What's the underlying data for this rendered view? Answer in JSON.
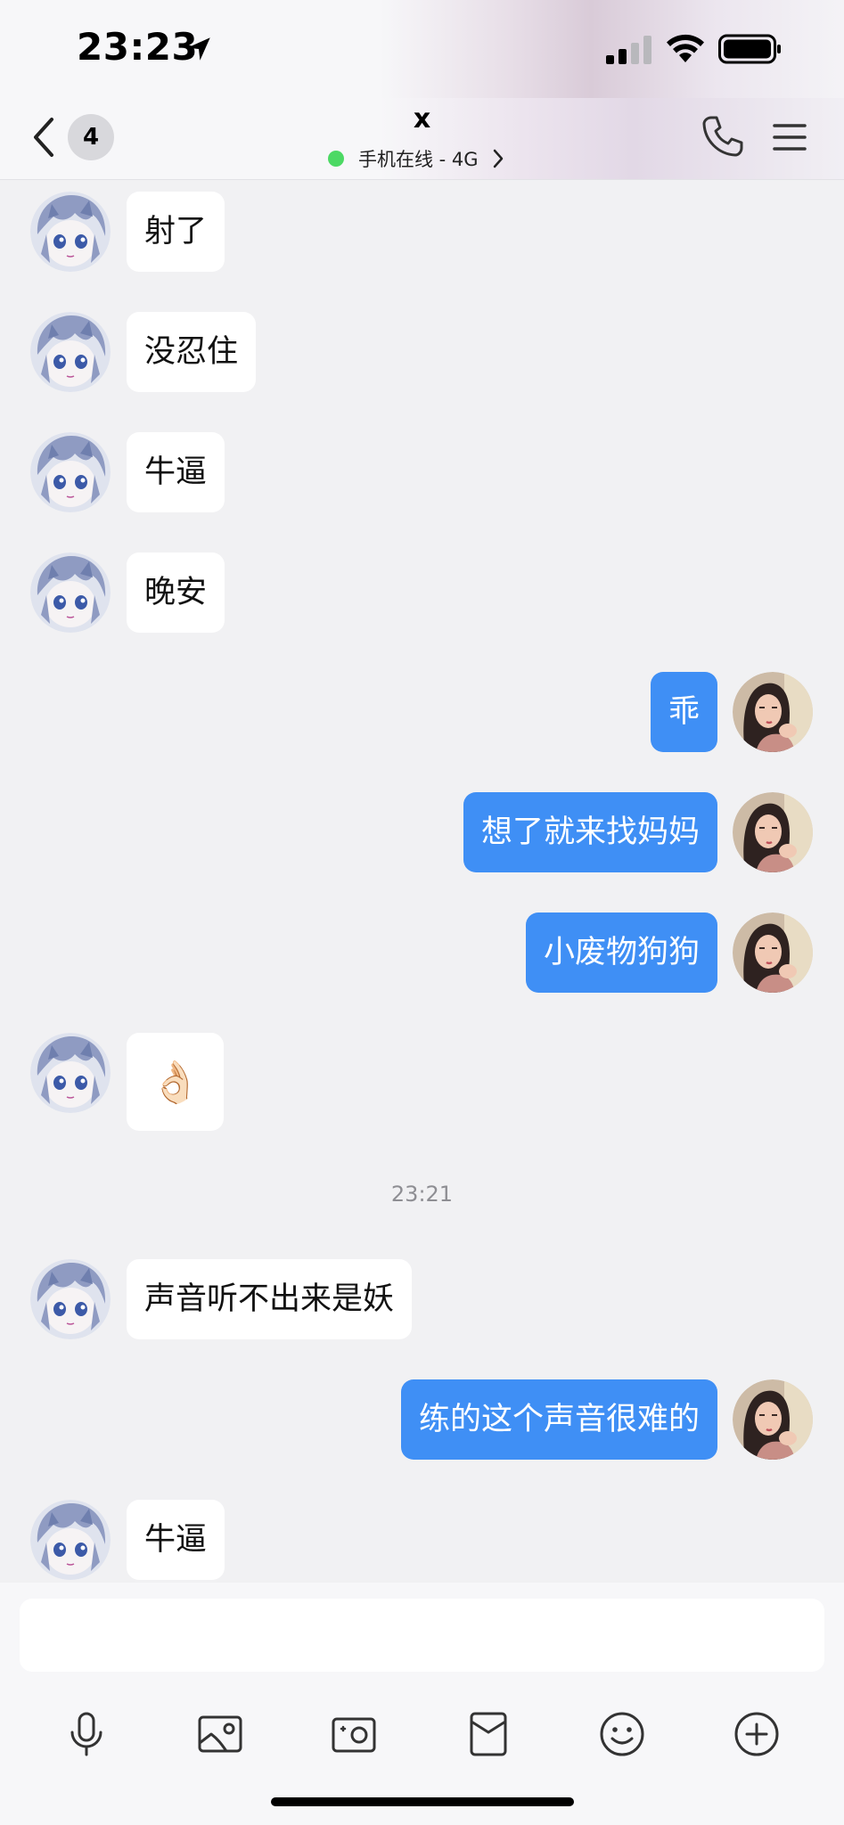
{
  "status_bar": {
    "time": "23:23"
  },
  "header": {
    "unread_count": "4",
    "title": "x",
    "online_status": "手机在线 - 4G",
    "accent_online_color": "#4cd964"
  },
  "messages": [
    {
      "side": "in",
      "text": "射了"
    },
    {
      "side": "in",
      "text": "没忍住"
    },
    {
      "side": "in",
      "text": "牛逼"
    },
    {
      "side": "in",
      "text": "晚安"
    },
    {
      "side": "out",
      "text": "乖"
    },
    {
      "side": "out",
      "text": "想了就来找妈妈"
    },
    {
      "side": "out",
      "text": "小废物狗狗"
    },
    {
      "side": "in",
      "text": "👌🏻",
      "emoji": true
    },
    {
      "side": "divider",
      "text": "23:21"
    },
    {
      "side": "in",
      "text": "声音听不出来是妖"
    },
    {
      "side": "out",
      "text": "练的这个声音很难的"
    },
    {
      "side": "in",
      "text": "牛逼"
    }
  ],
  "input": {
    "value": "",
    "placeholder": ""
  },
  "toolbar": [
    "mic-icon",
    "image-icon",
    "camera-icon",
    "red-packet-icon",
    "emoji-icon",
    "plus-icon"
  ],
  "colors": {
    "outgoing_bubble": "#3f8ff5",
    "incoming_bubble": "#ffffff",
    "background": "#f1f1f3"
  }
}
